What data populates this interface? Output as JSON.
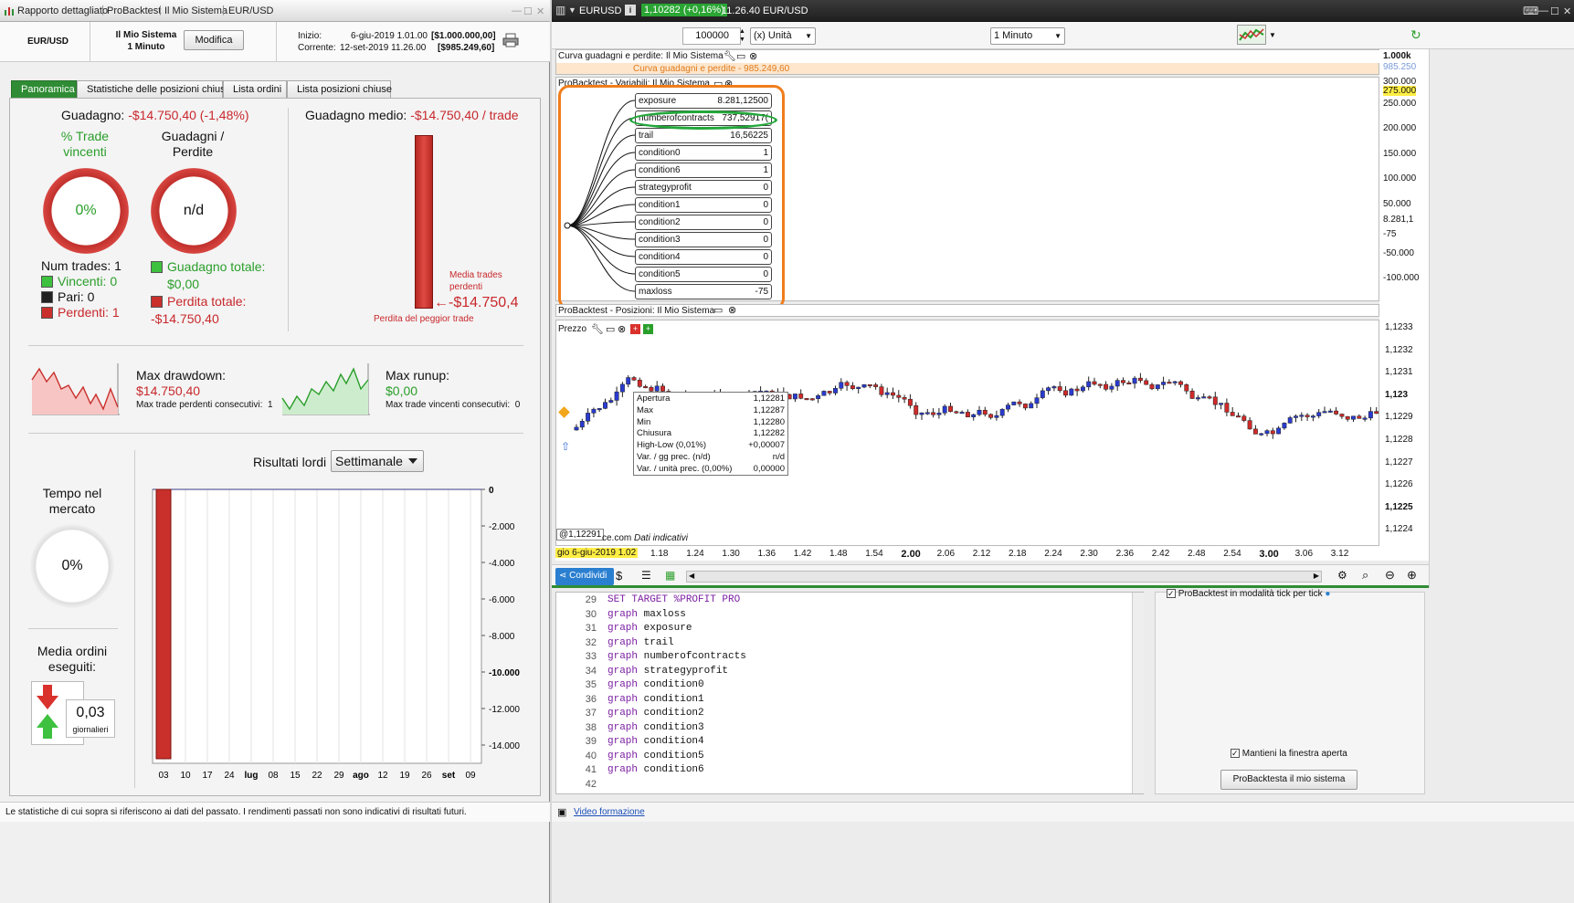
{
  "left_window": {
    "breadcrumbs": [
      "Rapporto dettagliato",
      "ProBacktest",
      "Il Mio Sistema",
      "EUR/USD"
    ],
    "instrument": "EUR/USD",
    "system_name": "Il Mio Sistema",
    "timeframe": "1 Minuto",
    "modify_button": "Modifica",
    "start_label": "Inizio:",
    "start_date": "6-giu-2019 1.01.00",
    "start_capital": "[$1.000.000,00]",
    "current_label": "Corrente:",
    "current_date": "12-set-2019 11.26.00",
    "current_capital": "[$985.249,60]",
    "tabs": [
      "Panoramica",
      "Statistiche delle posizioni chiuse",
      "Lista ordini",
      "Lista posizioni chiuse"
    ],
    "gain_label": "Guadagno:",
    "gain_value": "-$14.750,40 (-1,48%)",
    "pct_trade_title_1": "% Trade",
    "pct_trade_title_2": "vincenti",
    "pct_trade_value": "0%",
    "gl_title_1": "Guadagni /",
    "gl_title_2": "Perdite",
    "gl_value": "n/d",
    "num_trades": "Num trades: 1",
    "winners": "Vincenti: 0",
    "pairs": "Pari: 0",
    "losers": "Perdenti: 1",
    "total_gain_label": "Guadagno totale:",
    "total_gain_value": "$0,00",
    "total_loss_label": "Perdita totale:",
    "total_loss_value": "-$14.750,40",
    "avg_gain_label": "Guadagno medio:",
    "avg_gain_value": "-$14.750,40 / trade",
    "avg_losing_label_1": "Media trades",
    "avg_losing_label_2": "perdenti",
    "worst_trade_value": "-$14.750,4",
    "worst_trade_label": "Perdita del peggior trade",
    "max_drawdown_label": "Max drawdown:",
    "max_drawdown_value": "$14.750,40",
    "max_losing_consec": "Max trade perdenti consecutivi:  1",
    "max_runup_label": "Max runup:",
    "max_runup_value": "$0,00",
    "max_winning_consec": "Max trade vincenti consecutivi:  0",
    "time_in_market_1": "Tempo nel",
    "time_in_market_2": "mercato",
    "time_in_market_value": "0%",
    "avg_orders_1": "Media ordini",
    "avg_orders_2": "eseguiti:",
    "avg_orders_value": "0,03",
    "avg_orders_unit": "giornalieri",
    "results_label": "Risultati lordi",
    "results_period": "Settimanale",
    "footer_note": "Le statistiche di cui sopra si riferiscono ai dati del passato. I rendimenti passati non sono indicativi di risultati futuri."
  },
  "chart_data": {
    "type": "bar",
    "title": "Risultati lordi",
    "categories": [
      "03",
      "10",
      "17",
      "24",
      "lug",
      "08",
      "15",
      "22",
      "29",
      "ago",
      "12",
      "19",
      "26",
      "set",
      "09"
    ],
    "values": [
      -14750.4,
      0,
      0,
      0,
      0,
      0,
      0,
      0,
      0,
      0,
      0,
      0,
      0,
      0,
      0
    ],
    "y_ticks": [
      "0",
      "-2.000",
      "-4.000",
      "-6.000",
      "-8.000",
      "-10.000",
      "-12.000",
      "-14.000"
    ],
    "ylim": [
      -15000,
      0
    ],
    "color": "#c9302c"
  },
  "right_window": {
    "symbol": "EURUSD",
    "price_badge": "1,10282 (+0,16%)",
    "time_label": "11.26.40 EUR/USD",
    "quantity": "100000",
    "unit_select": "(x) Unità",
    "timeframe_select": "1 Minuto",
    "equity_panel_title": "Curva guadagni e perdite: Il Mio Sistema",
    "equity_hint": "Curva guadagni e perdite - 985.249,60",
    "variables_panel_title": "ProBacktest - Variabili: Il Mio Sistema",
    "positions_panel_title": "ProBacktest - Posizioni: Il Mio Sistema",
    "price_panel_title": "Prezzo",
    "variables": [
      {
        "name": "exposure",
        "value": "8.281,12500"
      },
      {
        "name": "numberofcontracts",
        "value": "737,52917("
      },
      {
        "name": "trail",
        "value": "16,56225"
      },
      {
        "name": "condition0",
        "value": "1"
      },
      {
        "name": "condition6",
        "value": "1"
      },
      {
        "name": "strategyprofit",
        "value": "0"
      },
      {
        "name": "condition1",
        "value": "0"
      },
      {
        "name": "condition2",
        "value": "0"
      },
      {
        "name": "condition3",
        "value": "0"
      },
      {
        "name": "condition4",
        "value": "0"
      },
      {
        "name": "condition5",
        "value": "0"
      },
      {
        "name": "maxloss",
        "value": "-75"
      }
    ],
    "upper_axis": [
      "1.000k",
      "985.250",
      "300.000",
      "275.000",
      "250.000",
      "200.000",
      "150.000",
      "100.000",
      "50.000",
      "8.281,1",
      "-75",
      "-50.000",
      "-100.000"
    ],
    "price_axis": [
      "1,1233",
      "1,1232",
      "1,1231",
      "1,123",
      "1,1229",
      "1,1228",
      "1,1227",
      "1,1226",
      "1,1225",
      "1,1224"
    ],
    "tooltip": [
      {
        "k": "Apertura",
        "v": "1,12281"
      },
      {
        "k": "Max",
        "v": "1,12287"
      },
      {
        "k": "Min",
        "v": "1,12280"
      },
      {
        "k": "Chiusura",
        "v": "1,12282"
      },
      {
        "k": "High-Low (0,01%)",
        "v": "+0,00007"
      },
      {
        "k": "Var. / gg prec. (n/d)",
        "v": "n/d"
      },
      {
        "k": "Var. / unità prec. (0,00%)",
        "v": "0,00000"
      }
    ],
    "cursor_price": "@1,12291",
    "source": "ce.com",
    "source_note": "Dati indicativi",
    "x_start": "gio 6-giu-2019 1.02",
    "x_labels": [
      "1.18",
      "1.24",
      "1.30",
      "1.36",
      "1.42",
      "1.48",
      "1.54",
      "2.00",
      "2.06",
      "2.12",
      "2.18",
      "2.24",
      "2.30",
      "2.36",
      "2.42",
      "2.48",
      "2.54",
      "3.00",
      "3.06",
      "3.12"
    ],
    "share_button": "Condividi",
    "code_lines": [
      {
        "n": "29",
        "t": "SET TARGET %PROFIT PRO"
      },
      {
        "n": "30",
        "k": "graph",
        "t": " maxloss"
      },
      {
        "n": "31",
        "k": "graph",
        "t": " exposure"
      },
      {
        "n": "32",
        "k": "graph",
        "t": " trail"
      },
      {
        "n": "33",
        "k": "graph",
        "t": " numberofcontracts"
      },
      {
        "n": "34",
        "k": "graph",
        "t": " strategyprofit"
      },
      {
        "n": "35",
        "k": "graph",
        "t": " condition0"
      },
      {
        "n": "36",
        "k": "graph",
        "t": " condition1"
      },
      {
        "n": "37",
        "k": "graph",
        "t": " condition2"
      },
      {
        "n": "38",
        "k": "graph",
        "t": " condition3"
      },
      {
        "n": "39",
        "k": "graph",
        "t": " condition4"
      },
      {
        "n": "40",
        "k": "graph",
        "t": " condition5"
      },
      {
        "n": "41",
        "k": "graph",
        "t": " condition6"
      },
      {
        "n": "42",
        "t": ""
      }
    ],
    "tick_mode_label": "ProBacktest in modalità tick per tick",
    "keep_open_label": "Mantieni la finestra aperta",
    "run_button": "ProBacktesta il mio sistema",
    "video_link": "Video formazione"
  },
  "colors": {
    "accent_green": "#2f8c34",
    "loss_red": "#c9302c",
    "highlight_orange": "#f07d1b",
    "marker_green": "#22a83a",
    "bull_blue": "#2a3bd1",
    "bear_red": "#d02a2a"
  }
}
